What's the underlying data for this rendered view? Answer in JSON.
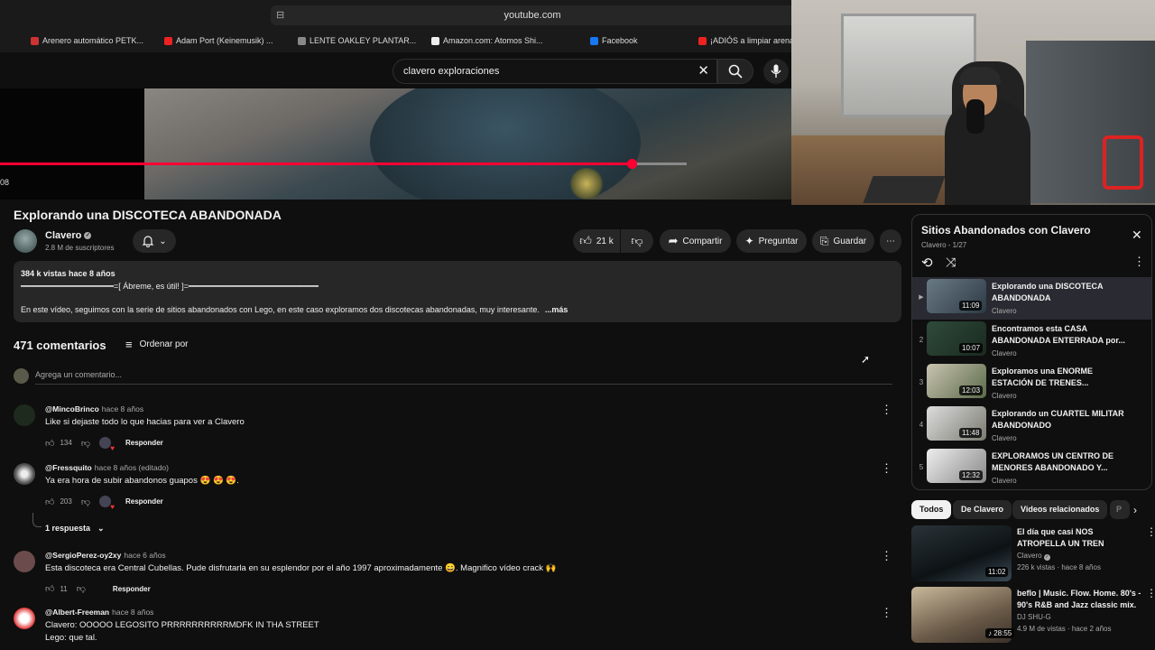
{
  "browser": {
    "url": "youtube.com",
    "bookmarks": [
      "Arenero automático PETK...",
      "Adam Port (Keinemusik) ...",
      "LENTE OAKLEY PLANTAR...",
      "Amazon.com: Atomos Shi...",
      "Facebook",
      "¡ADIÓS a limpiar arena"
    ]
  },
  "search": {
    "query": "clavero exploraciones"
  },
  "player": {
    "timecode": "08",
    "progress": 0.795,
    "buffered": 0.865
  },
  "video": {
    "title": "Explorando una DISCOTECA ABANDONADA",
    "channel": "Clavero",
    "subscribers": "2.8 M de suscriptores",
    "likes": "21 k",
    "share": "Compartir",
    "ask": "Preguntar",
    "save": "Guardar"
  },
  "description": {
    "views_date": "384 k vistas  hace 8 años",
    "line2": "━━━━━━━━━━━━━━━━━━━=[ Ábreme, es útil! ]=━━━━━━━━━━━━━━━━━━━━━━━━━━━━",
    "line3": "En este vídeo, seguimos con la serie de sitios abandonados con Lego, en este caso exploramos dos discotecas abandonadas, muy interesante.",
    "more": "...más"
  },
  "comments": {
    "count": "471 comentarios",
    "sort": "Ordenar por",
    "add_placeholder": "Agrega un comentario...",
    "reply_label": "Responder",
    "items": [
      {
        "user": "@MincoBrinco",
        "time": "hace 8 años",
        "text": "Like si dejaste todo lo que hacias para ver a Clavero",
        "likes": "134"
      },
      {
        "user": "@Fressquito",
        "time": "hace 8 años (editado)",
        "text": "Ya era hora de subir abandonos guapos 😍 😍 😍.",
        "likes": "203",
        "replies": "1 respuesta"
      },
      {
        "user": "@SergioPerez-oy2xy",
        "time": "hace 6 años",
        "text": "Esta discoteca era Central Cubellas. Pude disfrutarla en su esplendor por el año 1997 aproximadamente 😄. Magnifico vídeo crack 🙌",
        "likes": "11"
      },
      {
        "user": "@Albert-Freeman",
        "time": "hace 8 años",
        "text": "Clavero: OOOOO LEGOSITO PRRRRRRRRRRMDFK IN THA STREET",
        "text2": "Lego: que tal."
      }
    ]
  },
  "playlist": {
    "title": "Sitios Abandonados con Clavero",
    "meta": "Clavero - 1/27",
    "items": [
      {
        "n": "▶",
        "title": "Explorando una DISCOTECA ABANDONADA",
        "channel": "Clavero",
        "duration": "11:09"
      },
      {
        "n": "2",
        "title": "Encontramos esta CASA ABANDONADA ENTERRADA por...",
        "channel": "Clavero",
        "duration": "10:07"
      },
      {
        "n": "3",
        "title": "Exploramos una ENORME ESTACIÓN DE TRENES...",
        "channel": "Clavero",
        "duration": "12:03"
      },
      {
        "n": "4",
        "title": "Explorando un CUARTEL MILITAR ABANDONADO",
        "channel": "Clavero",
        "duration": "11:48"
      },
      {
        "n": "5",
        "title": "EXPLORAMOS UN CENTRO DE MENORES ABANDONADO Y...",
        "channel": "Clavero",
        "duration": "12:32"
      }
    ]
  },
  "chips": [
    "Todos",
    "De Clavero",
    "Videos relacionados",
    "P"
  ],
  "related": [
    {
      "title": "El día que casi NOS ATROPELLA UN TREN",
      "channel": "Clavero",
      "meta": "226 k vistas  ·  hace 8 años",
      "duration": "11:02"
    },
    {
      "title": "beflo | Music. Flow. Home. 80's - 90's R&B and Jazz classic mix.",
      "channel": "DJ SHU-G",
      "meta": "4.9 M de vistas  ·  hace 2 años",
      "duration": "28:55"
    }
  ]
}
